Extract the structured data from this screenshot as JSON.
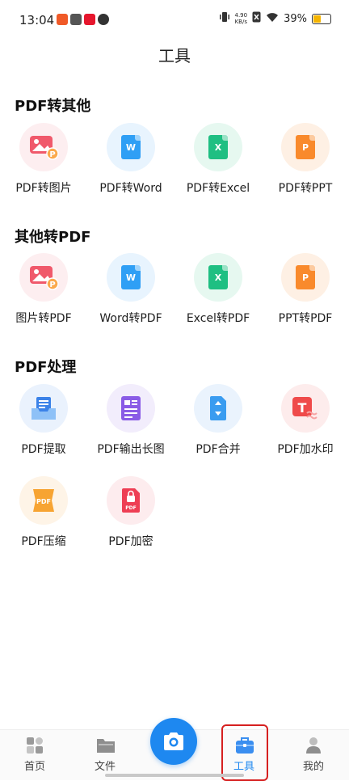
{
  "status_bar": {
    "time": "13:04",
    "speed_value": "4.90",
    "speed_unit": "KB/s",
    "battery": "39%",
    "battery_level": 0.39
  },
  "header": {
    "title": "工具"
  },
  "sections": [
    {
      "title": "PDF转其他",
      "tools": [
        {
          "label": "PDF转图片",
          "icon": "pdf-to-image-icon"
        },
        {
          "label": "PDF转Word",
          "icon": "word-doc-icon"
        },
        {
          "label": "PDF转Excel",
          "icon": "excel-doc-icon"
        },
        {
          "label": "PDF转PPT",
          "icon": "ppt-doc-icon"
        }
      ]
    },
    {
      "title": "其他转PDF",
      "tools": [
        {
          "label": "图片转PDF",
          "icon": "image-to-pdf-icon"
        },
        {
          "label": "Word转PDF",
          "icon": "word-doc-icon"
        },
        {
          "label": "Excel转PDF",
          "icon": "excel-doc-icon"
        },
        {
          "label": "PPT转PDF",
          "icon": "ppt-doc-icon"
        }
      ]
    },
    {
      "title": "PDF处理",
      "tools": [
        {
          "label": "PDF提取",
          "icon": "extract-icon"
        },
        {
          "label": "PDF输出长图",
          "icon": "long-image-icon"
        },
        {
          "label": "PDF合并",
          "icon": "merge-icon"
        },
        {
          "label": "PDF加水印",
          "icon": "watermark-icon"
        },
        {
          "label": "PDF压缩",
          "icon": "compress-icon"
        },
        {
          "label": "PDF加密",
          "icon": "encrypt-icon"
        }
      ]
    }
  ],
  "icon_letters": {
    "word": "W",
    "excel": "X",
    "ppt": "P",
    "pdf": "PDF",
    "watermark": "T"
  },
  "colors": {
    "word": "#2f9ff5",
    "excel": "#1fbf82",
    "ppt": "#f98a2c",
    "image": "#f0596b",
    "accent": "#1e88f0",
    "highlight": "#d62020"
  },
  "bottom_nav": {
    "home": "首页",
    "files": "文件",
    "tools": "工具",
    "mine": "我的",
    "active": "工具"
  }
}
